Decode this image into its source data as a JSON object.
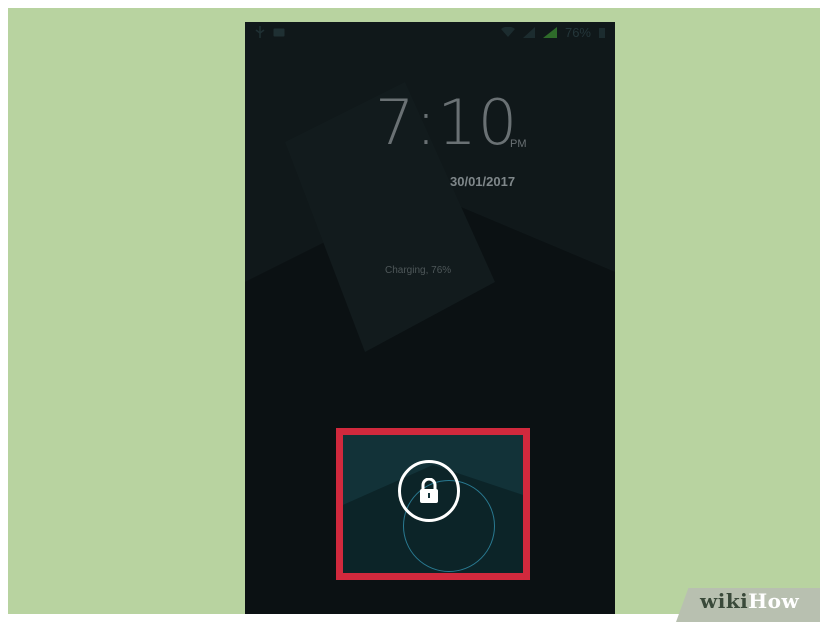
{
  "status_bar": {
    "battery_percent": "76%",
    "icons": [
      "usb-icon",
      "image-icon",
      "wifi-icon",
      "signal-icon",
      "signal-icon",
      "battery-icon"
    ]
  },
  "lock_screen": {
    "time": "7:10",
    "am_pm": "PM",
    "date": "30/01/2017",
    "charging_status": "Charging, 76%",
    "unlock_icon": "lock-icon",
    "bottom_labels": "",
    "highlight_color": "#d1293d"
  },
  "watermark": {
    "part1": "wiki",
    "part2": "How"
  },
  "colors": {
    "background": "#b8d3a0",
    "screen": "#0d1214",
    "accent_ring": "#2f8aa5"
  }
}
